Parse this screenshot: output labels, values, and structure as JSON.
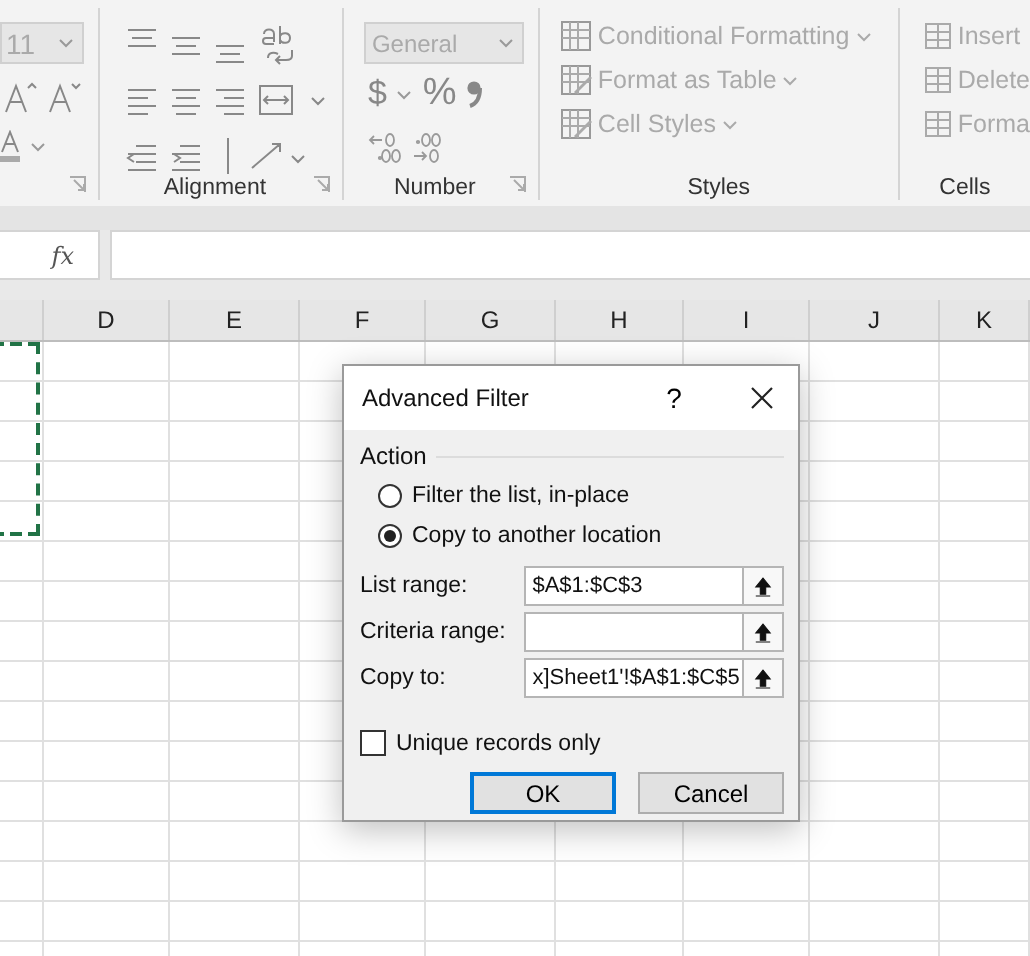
{
  "ribbon": {
    "font_size": "11",
    "alignment": {
      "label": "Alignment"
    },
    "number": {
      "format": "General",
      "currency": "$",
      "percent": "%",
      "label": "Number"
    },
    "styles": {
      "items": [
        {
          "label": "Conditional Formatting"
        },
        {
          "label": "Format as Table"
        },
        {
          "label": "Cell Styles"
        }
      ],
      "label": "Styles"
    },
    "cells": {
      "items": [
        {
          "label": "Insert"
        },
        {
          "label": "Delete"
        },
        {
          "label": "Forma"
        }
      ],
      "label": "Cells"
    }
  },
  "formula_bar": {
    "fx": "fx"
  },
  "columns": [
    "D",
    "E",
    "F",
    "G",
    "H",
    "I",
    "J",
    "K"
  ],
  "dialog": {
    "title": "Advanced Filter",
    "help": "?",
    "action_label": "Action",
    "options": [
      {
        "label": "Filter the list, in-place",
        "selected": false
      },
      {
        "label": "Copy to another location",
        "selected": true
      }
    ],
    "fields": [
      {
        "label": "List range:",
        "value": "$A$1:$C$3"
      },
      {
        "label": "Criteria range:"
      },
      {
        "label": "Copy to:",
        "value": "x]Sheet1'!$A$1:$C$5"
      }
    ],
    "unique": {
      "label": "Unique records only",
      "checked": false
    },
    "buttons": [
      {
        "label": "OK",
        "kind": "default"
      },
      {
        "label": "Cancel",
        "kind": "normal"
      }
    ]
  }
}
